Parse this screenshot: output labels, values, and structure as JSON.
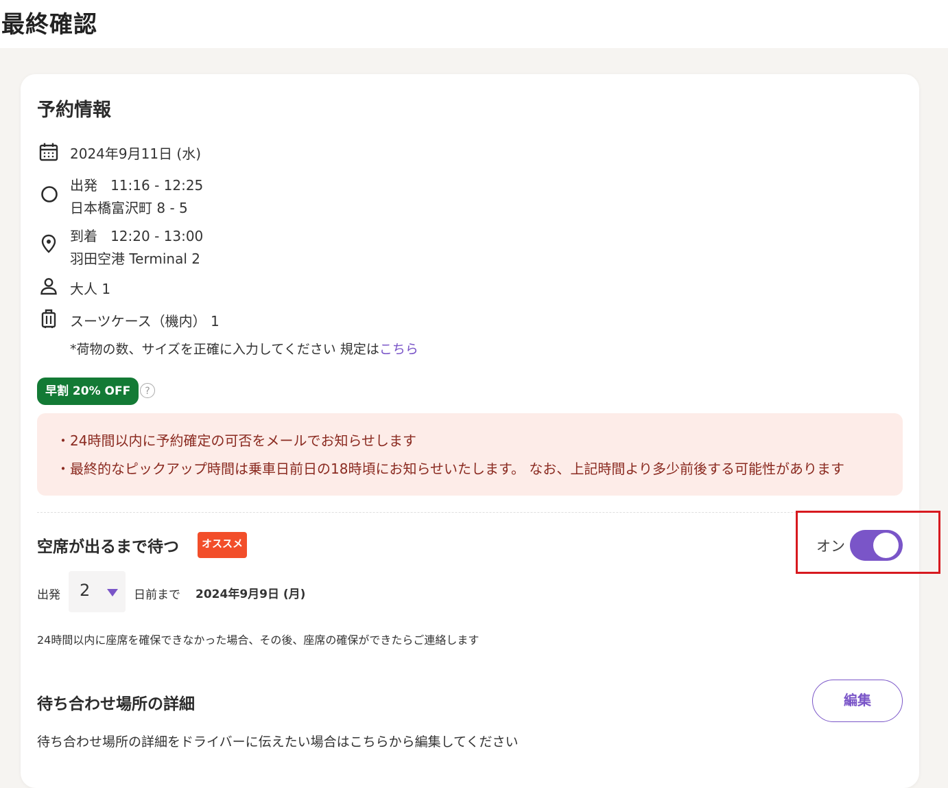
{
  "page": {
    "title": "最終確認"
  },
  "reservation": {
    "section_title": "予約情報",
    "date": "2024年9月11日 (水)",
    "departure": {
      "label": "出発",
      "time": "11:16 - 12:25",
      "place": "日本橋富沢町 8 - 5"
    },
    "arrival": {
      "label": "到着",
      "time": "12:20 - 13:00",
      "place": "羽田空港 Terminal 2"
    },
    "passengers": "大人 1",
    "luggage": "スーツケース（機内） 1",
    "luggage_note": "*荷物の数、サイズを正確に入力してください 規定は",
    "luggage_note_link": "こちら",
    "discount_badge": "早割 20% OFF",
    "help_icon_glyph": "?",
    "notices": [
      "・24時間以内に予約確定の可否をメールでお知らせします",
      "・最終的なピックアップ時間は乗車日前日の18時頃にお知らせいたします。 なお、上記時間より多少前後する可能性があります"
    ]
  },
  "waitlist": {
    "title": "空席が出るまで待つ",
    "recommend_badge": "オススメ",
    "toggle_label": "オン",
    "toggle_on": true,
    "departure_label": "出発",
    "days_value": "2",
    "days_suffix": "日前まで",
    "deadline_date": "2024年9月9日 (月)",
    "note": "24時間以内に座席を確保できなかった場合、その後、座席の確保ができたらご連絡します"
  },
  "meeting": {
    "title": "待ち合わせ場所の詳細",
    "edit_label": "編集",
    "description": "待ち合わせ場所の詳細をドライバーに伝えたい場合はこちらから編集してください"
  },
  "colors": {
    "accent": "#7a55c8",
    "discount": "#137a35",
    "recommend": "#f24e2a",
    "notice_bg": "#fdece8",
    "notice_text": "#8a2a20",
    "highlight": "#d7191f"
  },
  "icons": [
    "calendar-icon",
    "circle-origin-icon",
    "map-pin-icon",
    "person-icon",
    "suitcase-icon",
    "help-circle-icon"
  ]
}
